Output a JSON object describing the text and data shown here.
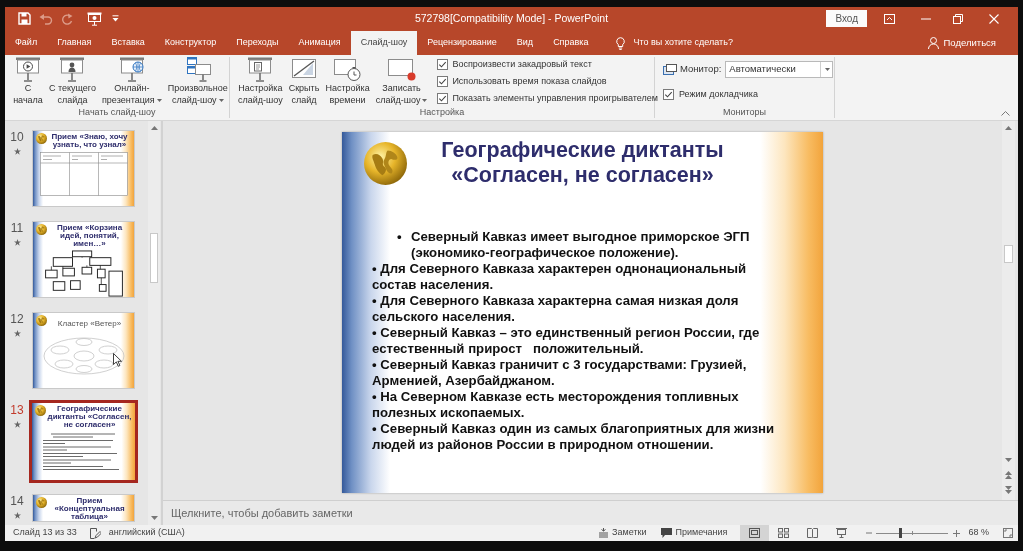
{
  "window": {
    "title": "572798[Compatibility Mode] - PowerPoint",
    "sign_in": "Вход"
  },
  "quick_access": [
    {
      "kind": "save",
      "disabled": false
    },
    {
      "kind": "undo",
      "disabled": true
    },
    {
      "kind": "redo",
      "disabled": true
    },
    {
      "kind": "present",
      "disabled": false
    },
    {
      "kind": "customize",
      "disabled": false
    }
  ],
  "tabs": [
    {
      "label": "Файл",
      "selected": false
    },
    {
      "label": "Главная",
      "selected": false
    },
    {
      "label": "Вставка",
      "selected": false
    },
    {
      "label": "Конструктор",
      "selected": false
    },
    {
      "label": "Переходы",
      "selected": false
    },
    {
      "label": "Анимация",
      "selected": false
    },
    {
      "label": "Слайд-шоу",
      "selected": true
    },
    {
      "label": "Рецензирование",
      "selected": false
    },
    {
      "label": "Вид",
      "selected": false
    },
    {
      "label": "Справка",
      "selected": false
    }
  ],
  "tell_me": "Что вы хотите сделать?",
  "share": "Поделиться",
  "ribbon": {
    "groups": [
      {
        "label": "Начать слайд-шоу",
        "buttons": [
          {
            "kind": "from-start",
            "lines": [
              "С",
              "начала"
            ],
            "menu": false
          },
          {
            "kind": "from-current",
            "lines": [
              "С текущего",
              "слайда"
            ],
            "menu": false
          },
          {
            "kind": "online",
            "lines": [
              "Онлайн-",
              "презентация"
            ],
            "menu": true
          },
          {
            "kind": "custom",
            "lines": [
              "Произвольное",
              "слайд-шоу"
            ],
            "menu": true
          }
        ]
      },
      {
        "label": "Настройка",
        "buttons": [
          {
            "kind": "setup",
            "lines": [
              "Настройка",
              "слайд-шоу"
            ],
            "menu": false
          },
          {
            "kind": "hide",
            "lines": [
              "Скрыть",
              "слайд"
            ],
            "menu": false
          },
          {
            "kind": "timing",
            "lines": [
              "Настройка",
              "времени"
            ],
            "menu": false
          },
          {
            "kind": "record",
            "lines": [
              "Записать",
              "слайд-шоу"
            ],
            "menu": true
          }
        ],
        "checkboxes": [
          {
            "label": "Воспроизвести закадровый текст",
            "checked": true
          },
          {
            "label": "Использовать время показа слайдов",
            "checked": true
          },
          {
            "label": "Показать элементы управления проигрывателем",
            "checked": true
          }
        ]
      },
      {
        "label": "Мониторы",
        "monitor": {
          "label": "Монитор:",
          "value": "Автоматически"
        },
        "checkboxes": [
          {
            "label": "Режим докладчика",
            "checked": true
          }
        ]
      }
    ]
  },
  "thumbnails": [
    {
      "number": "10",
      "title": "Прием «Знаю, хочу узнать, что узнал»",
      "title_bold": true,
      "kind": "table",
      "transition": true,
      "selected": false,
      "cursor": false
    },
    {
      "number": "11",
      "title": "Прием «Корзина идей, понятий, имен…»",
      "title_bold": true,
      "kind": "diagram",
      "transition": true,
      "selected": false,
      "cursor": false
    },
    {
      "number": "12",
      "title": "Кластер «Ветер»",
      "title_bold": false,
      "kind": "cluster",
      "transition": true,
      "selected": false,
      "cursor": true
    },
    {
      "number": "13",
      "title": "Географические диктанты «Согласен, не согласен»",
      "title_bold": true,
      "kind": "text",
      "transition": true,
      "selected": true,
      "cursor": false
    },
    {
      "number": "14",
      "title": "Прием «Концептуальная таблица»",
      "title_bold": true,
      "kind": "caption",
      "transition": true,
      "selected": false,
      "cursor": false
    }
  ],
  "slide": {
    "title": "Географические диктанты\n«Согласен, не согласен»",
    "items": [
      {
        "kind": "indented",
        "marker": "•",
        "text": "Северный Кавказ имеет выгодное приморское ЭГП (экономико-географическое положение)."
      },
      {
        "kind": "plain",
        "text": "• Для Северного Кавказа характерен однонациональный состав населения."
      },
      {
        "kind": "plain",
        "text": "• Для Северного Кавказа характерна самая низкая доля сельского населения."
      },
      {
        "kind": "plain",
        "text": "• Северный Кавказ – это единственный регион России, где естественный прирост   положительный."
      },
      {
        "kind": "plain",
        "text": "• Северный Кавказ граничит с 3 государствами: Грузией, Арменией, Азербайджаном."
      },
      {
        "kind": "plain",
        "text": "• На Северном Кавказе есть месторождения топливных полезных ископаемых."
      },
      {
        "kind": "plain",
        "text": "• Северный Кавказ один из самых благоприятных для жизни людей из районов России в природном отношении."
      }
    ]
  },
  "notes": {
    "placeholder": "Щелкните, чтобы добавить заметки"
  },
  "status_bar": {
    "slide_counter": "Слайд 13 из 33",
    "language": "английский (США)",
    "notes": "Заметки",
    "comments": "Примечания",
    "views": [
      {
        "kind": "normal",
        "selected": true
      },
      {
        "kind": "sorter",
        "selected": false
      },
      {
        "kind": "reading",
        "selected": false
      },
      {
        "kind": "slideshow",
        "selected": false
      }
    ],
    "zoom": {
      "level": 0.34,
      "reading": "68 %"
    }
  }
}
